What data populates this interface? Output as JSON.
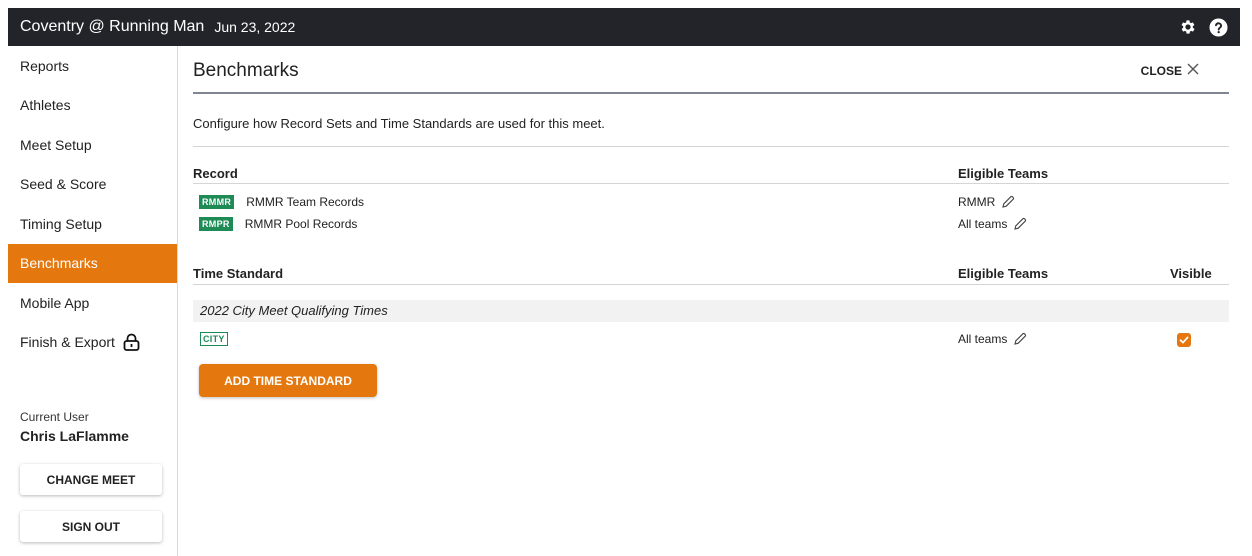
{
  "topbar": {
    "meet_name": "Coventry @ Running Man",
    "date": "Jun 23, 2022",
    "icons": [
      "gear-icon",
      "help-icon"
    ]
  },
  "sidebar": {
    "items": [
      {
        "label": "Reports"
      },
      {
        "label": "Athletes"
      },
      {
        "label": "Meet Setup"
      },
      {
        "label": "Seed & Score"
      },
      {
        "label": "Timing Setup"
      },
      {
        "label": "Benchmarks",
        "active": true
      },
      {
        "label": "Mobile App"
      },
      {
        "label": "Finish & Export",
        "icon": "lock-icon"
      }
    ],
    "user_caption": "Current User",
    "user_name": "Chris LaFlamme",
    "change_meet_label": "CHANGE MEET",
    "sign_out_label": "SIGN OUT"
  },
  "main": {
    "title": "Benchmarks",
    "close_label": "CLOSE",
    "intro": "Configure how Record Sets and Time Standards are used for this meet.",
    "records": {
      "header_record": "Record",
      "header_eligible": "Eligible Teams",
      "rows": [
        {
          "badge": "RMMR",
          "name": "RMMR Team Records",
          "eligible": "RMMR"
        },
        {
          "badge": "RMPR",
          "name": "RMMR Pool Records",
          "eligible": "All teams"
        }
      ]
    },
    "time_standards": {
      "header_standard": "Time Standard",
      "header_eligible": "Eligible Teams",
      "header_visible": "Visible",
      "group": "2022 City Meet Qualifying Times",
      "rows": [
        {
          "badge": "CITY",
          "eligible": "All teams",
          "visible": true
        }
      ],
      "add_label": "ADD TIME STANDARD"
    }
  },
  "colors": {
    "accent": "#e4780f",
    "badge_green": "#1e8a56",
    "topbar": "#23232a"
  }
}
